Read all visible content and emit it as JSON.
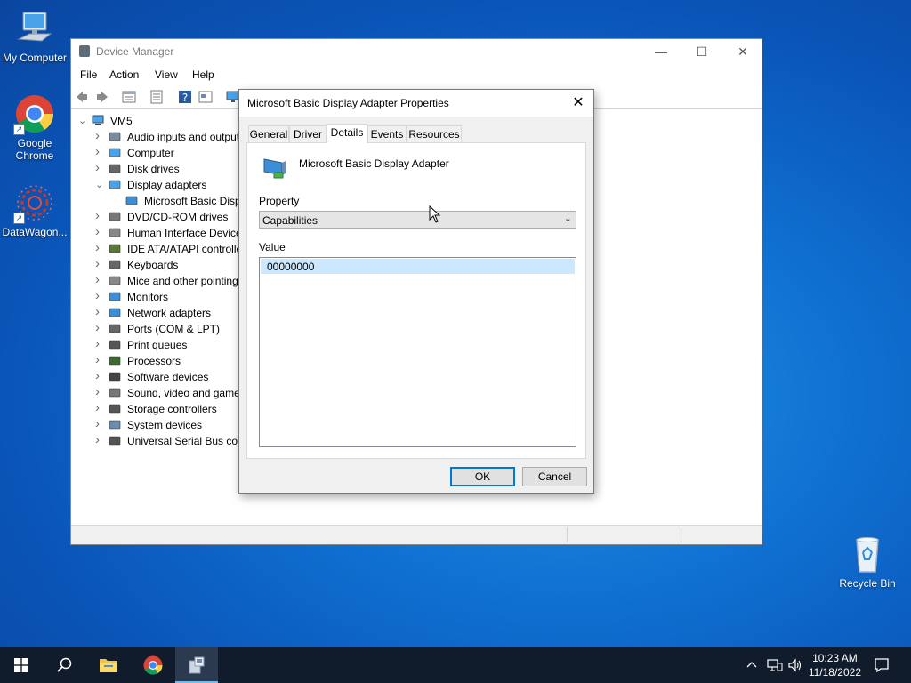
{
  "desktop": {
    "icons": [
      {
        "label": "My Computer"
      },
      {
        "label": "Google Chrome"
      },
      {
        "label": "DataWagon..."
      },
      {
        "label": "Recycle Bin"
      }
    ]
  },
  "device_manager": {
    "title": "Device Manager",
    "menu": [
      "File",
      "Action",
      "View",
      "Help"
    ],
    "root": "VM5",
    "categories": [
      {
        "label": "Audio inputs and outputs",
        "expanded": false
      },
      {
        "label": "Computer",
        "expanded": false
      },
      {
        "label": "Disk drives",
        "expanded": false
      },
      {
        "label": "Display adapters",
        "expanded": true
      },
      {
        "label": "Microsoft Basic Display Adapter",
        "child": true
      },
      {
        "label": "DVD/CD-ROM drives",
        "expanded": false
      },
      {
        "label": "Human Interface Devices",
        "expanded": false
      },
      {
        "label": "IDE ATA/ATAPI controllers",
        "expanded": false
      },
      {
        "label": "Keyboards",
        "expanded": false
      },
      {
        "label": "Mice and other pointing devices",
        "expanded": false
      },
      {
        "label": "Monitors",
        "expanded": false
      },
      {
        "label": "Network adapters",
        "expanded": false
      },
      {
        "label": "Ports (COM & LPT)",
        "expanded": false
      },
      {
        "label": "Print queues",
        "expanded": false
      },
      {
        "label": "Processors",
        "expanded": false
      },
      {
        "label": "Software devices",
        "expanded": false
      },
      {
        "label": "Sound, video and game controllers",
        "expanded": false
      },
      {
        "label": "Storage controllers",
        "expanded": false
      },
      {
        "label": "System devices",
        "expanded": false
      },
      {
        "label": "Universal Serial Bus controllers",
        "expanded": false
      }
    ]
  },
  "dialog": {
    "title": "Microsoft Basic Display Adapter Properties",
    "tabs": [
      "General",
      "Driver",
      "Details",
      "Events",
      "Resources"
    ],
    "active_tab": "Details",
    "device_name": "Microsoft Basic Display Adapter",
    "property_label": "Property",
    "property_value": "Capabilities",
    "value_label": "Value",
    "values": [
      "00000000"
    ],
    "ok_label": "OK",
    "cancel_label": "Cancel"
  },
  "taskbar": {
    "time": "10:23 AM",
    "date": "11/18/2022"
  },
  "colors": {
    "desktop": "#0f6fd0",
    "taskbar": "#101b2b",
    "selection": "#cce8ff",
    "accent": "#0078d7"
  }
}
